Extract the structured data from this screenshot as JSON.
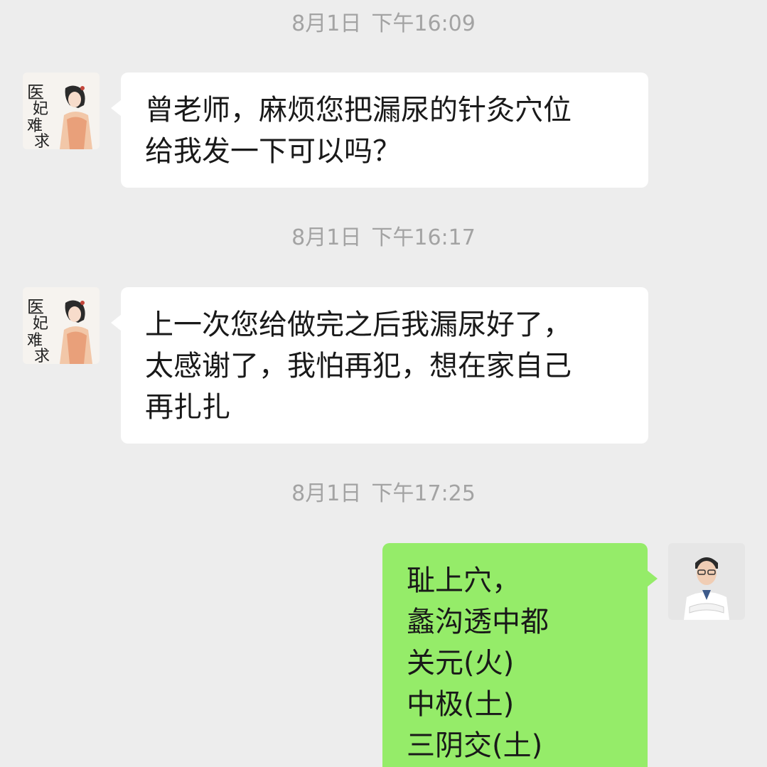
{
  "messages": [
    {
      "time": {
        "date": "8月1日",
        "clock": "下午16:09"
      },
      "sender": "contact",
      "lines": [
        "曾老师，麻烦您把漏尿的针灸穴位",
        "给我发一下可以吗？"
      ]
    },
    {
      "time": {
        "date": "8月1日",
        "clock": "下午16:17"
      },
      "sender": "contact",
      "lines": [
        "上一次您给做完之后我漏尿好了，",
        "太感谢了，我怕再犯，想在家自己",
        "再扎扎"
      ]
    },
    {
      "time": {
        "date": "8月1日",
        "clock": "下午17:25"
      },
      "sender": "me",
      "lines": [
        "耻上穴，",
        "蠡沟透中都",
        "关元(火)",
        "中极(土)",
        "三阴交(土)"
      ]
    }
  ],
  "avatars": {
    "contact": {
      "icon": "contact-avatar-icon",
      "art_text": "医妃难求"
    },
    "me": {
      "icon": "doctor-avatar-icon"
    }
  },
  "colors": {
    "background": "#ededed",
    "incoming_bubble": "#ffffff",
    "outgoing_bubble": "#95ec69",
    "timestamp": "#a3a3a3"
  }
}
